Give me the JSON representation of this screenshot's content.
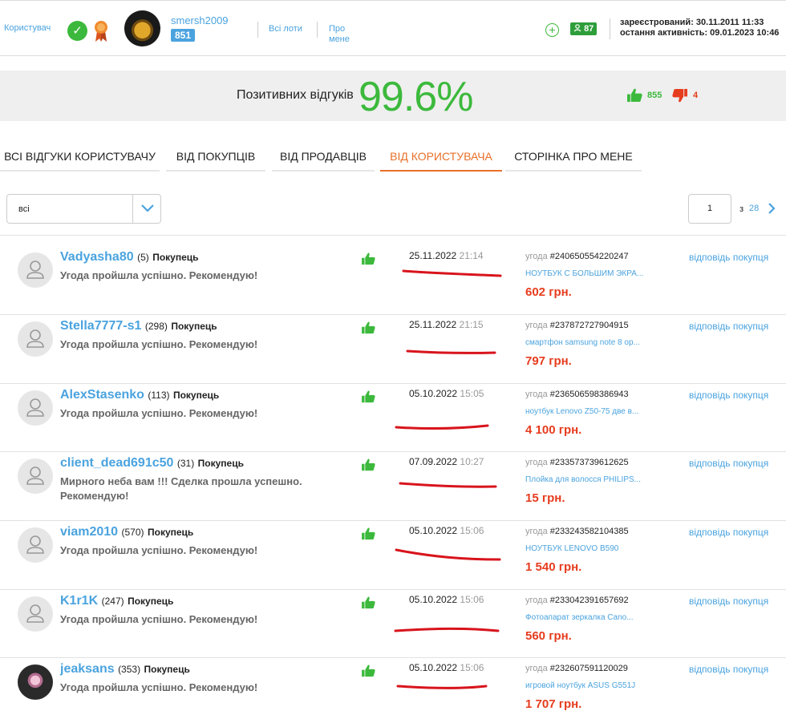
{
  "header": {
    "user_label": "Користувач",
    "username": "smersh2009",
    "rating": "851",
    "all_lots": "Всі лоти",
    "about_line1": "Про",
    "about_line2": "мене",
    "count": "87",
    "registered": "зареєстрований: 30.11.2011 11:33",
    "last_active": "остання активність: 09.01.2023 10:46",
    "icon_names": [
      "check-icon",
      "medal-icon",
      "plus-icon",
      "user-icon"
    ]
  },
  "summary": {
    "label": "Позитивних відгуків",
    "value": "99.6%",
    "positive_count": "855",
    "negative_count": "4"
  },
  "tabs": [
    {
      "label": "ВСІ ВІДГУКИ КОРИСТУВАЧУ"
    },
    {
      "label": "ВІД ПОКУПЦІВ"
    },
    {
      "label": "ВІД ПРОДАВЦІВ"
    },
    {
      "label": "ВІД КОРИСТУВАЧА"
    },
    {
      "label": "СТОРІНКА ПРО МЕНЕ"
    }
  ],
  "active_tab": "ВІД КОРИСТУВАЧА",
  "filter": {
    "value": "всі"
  },
  "pagination": {
    "current": "1",
    "of_label": "з",
    "total": "28"
  },
  "reviews": [
    {
      "name": "Vadyasha80",
      "count": "(5)",
      "role": "Покупець",
      "text": "Угода пройшла успішно. Рекомендую!",
      "date": "25.11.2022",
      "time": "21:14",
      "deal_label": "угода",
      "deal_id": "#240650554220247",
      "item": "НОУТБУК С БОЛЬШИМ ЭКРА...",
      "price": "602 грн.",
      "reply": "відповідь покупця"
    },
    {
      "name": "Stella7777-s1",
      "count": "(298)",
      "role": "Покупець",
      "text": "Угода пройшла успішно. Рекомендую!",
      "date": "25.11.2022",
      "time": "21:15",
      "deal_label": "угода",
      "deal_id": "#237872727904915",
      "item": "смартфон samsung note 8 ор...",
      "price": "797 грн.",
      "reply": "відповідь покупця"
    },
    {
      "name": "AlexStasenko",
      "count": "(113)",
      "role": "Покупець",
      "text": "Угода пройшла успішно. Рекомендую!",
      "date": "05.10.2022",
      "time": "15:05",
      "deal_label": "угода",
      "deal_id": "#236506598386943",
      "item": "ноутбук Lenovo Z50-75 две в...",
      "price": "4 100 грн.",
      "reply": "відповідь покупця"
    },
    {
      "name": "client_dead691c50",
      "count": "(31)",
      "role": "Покупець",
      "text": "Мирного неба вам !!! Сделка прошла успешно. Рекомендую!",
      "date": "07.09.2022",
      "time": "10:27",
      "deal_label": "угода",
      "deal_id": "#233573739612625",
      "item": "Плойка для волосся PHILIPS...",
      "price": "15 грн.",
      "reply": "відповідь покупця"
    },
    {
      "name": "viam2010",
      "count": "(570)",
      "role": "Покупець",
      "text": "Угода пройшла успішно. Рекомендую!",
      "date": "05.10.2022",
      "time": "15:06",
      "deal_label": "угода",
      "deal_id": "#233243582104385",
      "item": "НОУТБУК LENOVO B590",
      "price": "1 540 грн.",
      "reply": "відповідь покупця"
    },
    {
      "name": "K1r1K",
      "count": "(247)",
      "role": "Покупець",
      "text": "Угода пройшла успішно. Рекомендую!",
      "date": "05.10.2022",
      "time": "15:06",
      "deal_label": "угода",
      "deal_id": "#233042391657692",
      "item": "Фотоапарат зеркалка Cano...",
      "price": "560 грн.",
      "reply": "відповідь покупця"
    },
    {
      "name": "jeaksans",
      "count": "(353)",
      "role": "Покупець",
      "text": "Угода пройшла успішно. Рекомендую!",
      "date": "05.10.2022",
      "time": "15:06",
      "deal_label": "угода",
      "deal_id": "#232607591120029",
      "item": "игровой ноутбук ASUS G551J",
      "price": "1 707 грн.",
      "reply": "відповідь покупця"
    }
  ],
  "colors": {
    "accent_blue": "#4aa3df",
    "positive_green": "#3cb93c",
    "price_red": "#e63c1e",
    "active_tab_orange": "#e8702a",
    "annotation_red": "#d8141c"
  }
}
